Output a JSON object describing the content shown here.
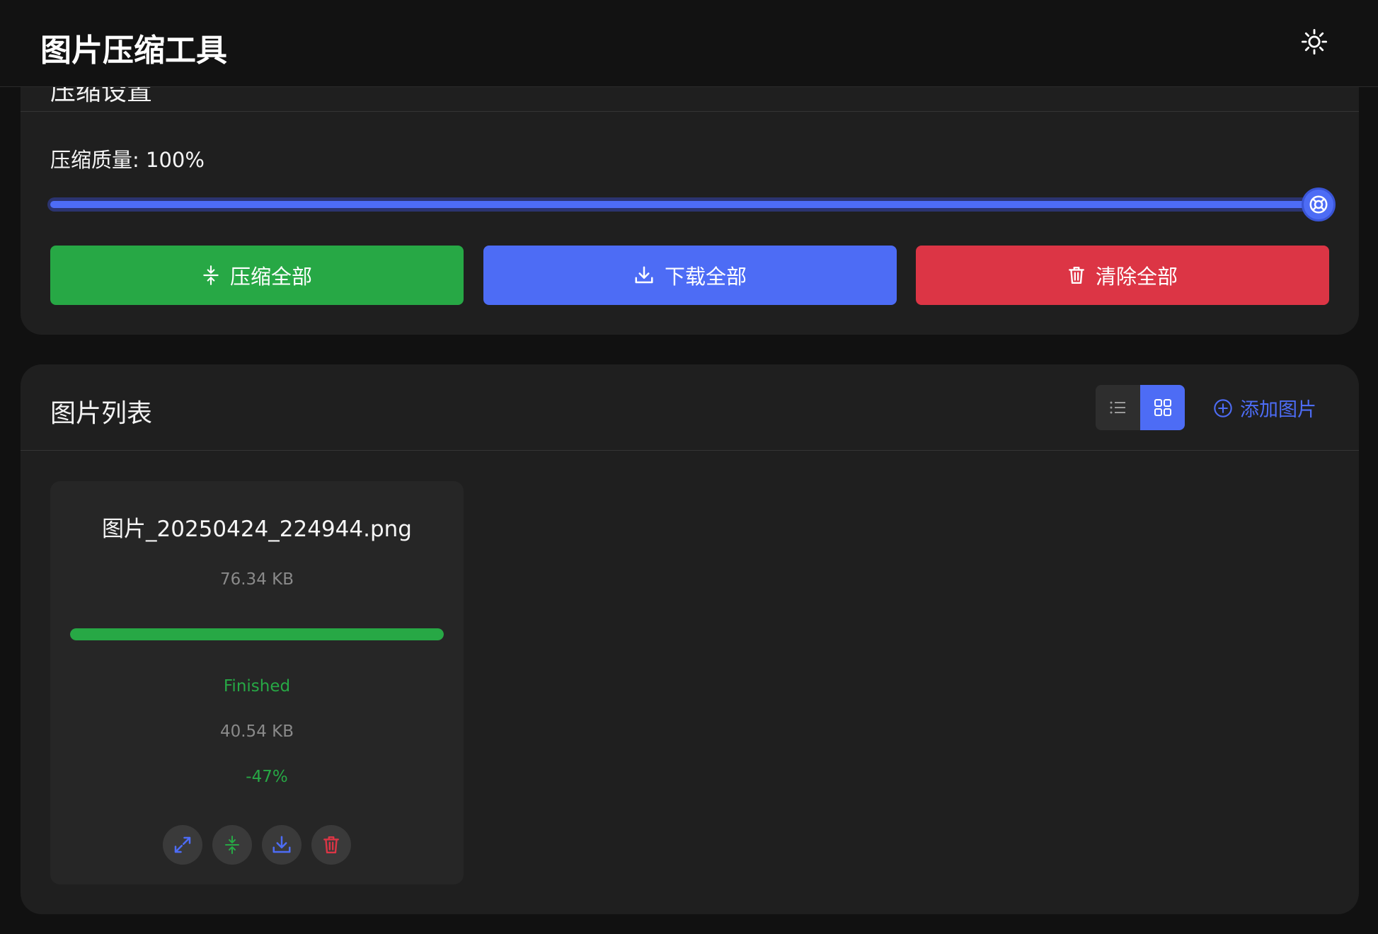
{
  "header": {
    "title": "图片压缩工具",
    "theme_icon": "sun-icon"
  },
  "settings": {
    "section_title": "压缩设置",
    "quality_label": "压缩质量:",
    "quality_value": "100%",
    "slider_value_percent": 100,
    "buttons": {
      "compress_all": "压缩全部",
      "download_all": "下载全部",
      "clear_all": "清除全部"
    }
  },
  "image_list": {
    "title": "图片列表",
    "view_modes": [
      "list",
      "grid"
    ],
    "active_view": "grid",
    "add_label": "添加图片",
    "items": [
      {
        "filename": "图片_20250424_224944.png",
        "original_size": "76.34 KB",
        "progress_percent": 100,
        "status": "Finished",
        "compressed_size": "40.54 KB",
        "ratio": "-47%"
      }
    ]
  },
  "colors": {
    "background": "#111111",
    "panel": "#1f1f1f",
    "card": "#262626",
    "green": "#27a845",
    "blue": "#4d6cf5",
    "red": "#dc3545",
    "muted": "#8a8a8a"
  }
}
